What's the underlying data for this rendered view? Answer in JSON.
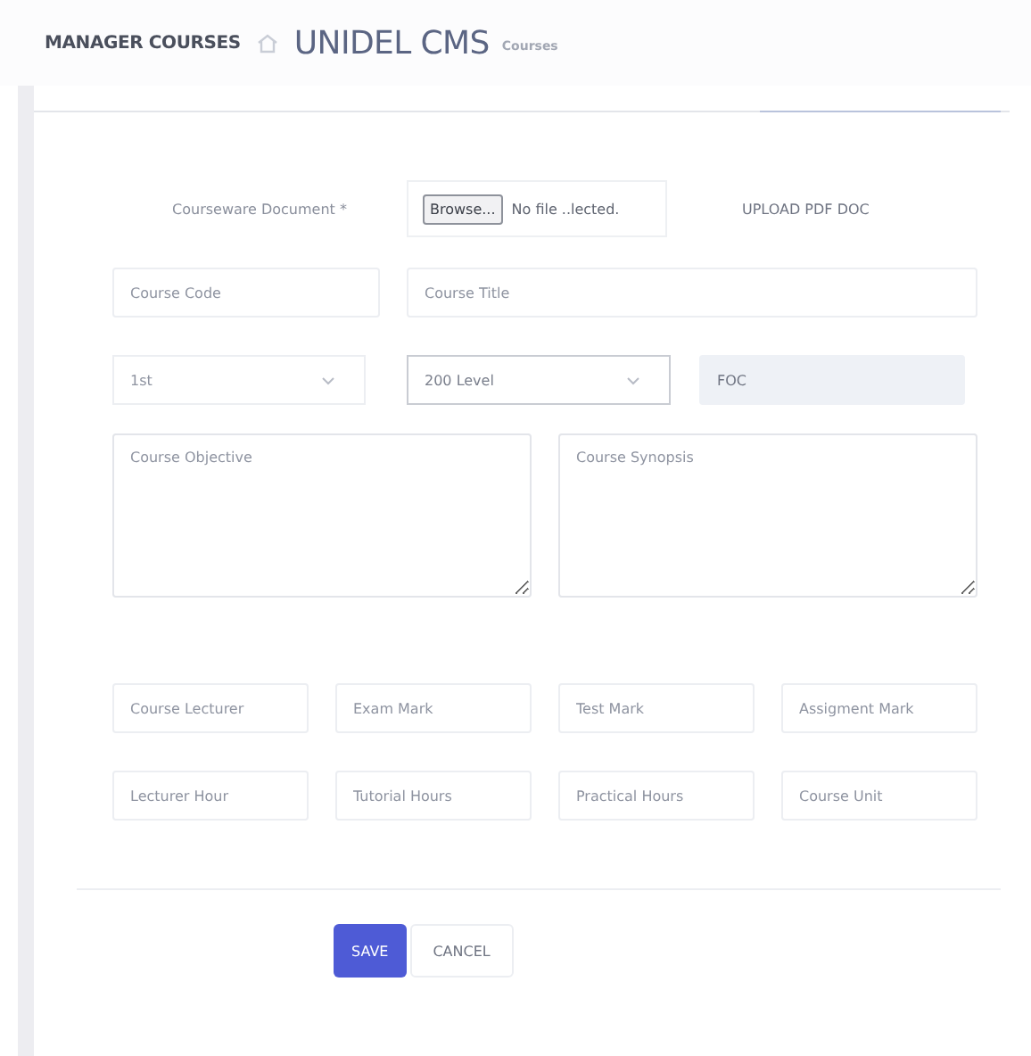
{
  "header": {
    "section": "MANAGER COURSES",
    "title": "UNIDEL CMS",
    "subtitle": "Courses"
  },
  "upload": {
    "label": "Courseware Document *",
    "browse": "Browse...",
    "file_name": "No file ..lected.",
    "hint": "UPLOAD PDF DOC"
  },
  "code": {
    "placeholder": "Course Code"
  },
  "title": {
    "placeholder": "Course Title"
  },
  "semester": {
    "value": "1st"
  },
  "level": {
    "value": "200 Level"
  },
  "faculty": {
    "value": "FOC",
    "disabled": true
  },
  "objective": {
    "placeholder": "Course Objective"
  },
  "synopsis": {
    "placeholder": "Course Synopsis"
  },
  "fields": [
    {
      "placeholder": "Course Lecturer"
    },
    {
      "placeholder": "Exam Mark"
    },
    {
      "placeholder": "Test Mark"
    },
    {
      "placeholder": "Assigment Mark"
    },
    {
      "placeholder": "Lecturer Hour"
    },
    {
      "placeholder": "Tutorial Hours"
    },
    {
      "placeholder": "Practical Hours"
    },
    {
      "placeholder": "Course Unit"
    }
  ],
  "buttons": [
    {
      "label": "SAVE",
      "kind": "primary"
    },
    {
      "label": "CANCEL",
      "kind": "secondary"
    }
  ]
}
